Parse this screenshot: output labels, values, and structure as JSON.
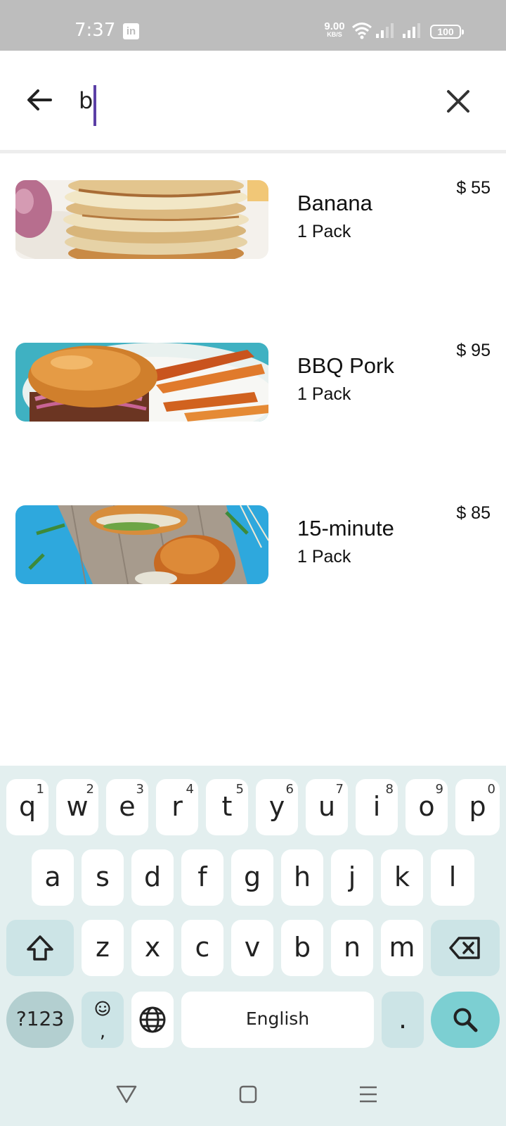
{
  "status_bar": {
    "time": "7:37",
    "notification_icon": "linkedin-icon",
    "notification_letters": "in",
    "net_speed_value": "9.00",
    "net_speed_unit": "KB/S",
    "battery": "100"
  },
  "search": {
    "query": "b",
    "back_icon": "arrow-left-icon",
    "clear_icon": "close-icon",
    "caret_color": "#5b3fa6"
  },
  "results": [
    {
      "name": "Banana",
      "quantity": "1 Pack",
      "price": "$ 55",
      "image": "pancake-stack-photo"
    },
    {
      "name": "BBQ Pork",
      "quantity": "1 Pack",
      "price": "$ 95",
      "image": "burger-with-fries-photo"
    },
    {
      "name": "15-minute",
      "quantity": "1 Pack",
      "price": "$ 85",
      "image": "burger-on-board-photo"
    }
  ],
  "keyboard": {
    "row1": [
      {
        "key": "q",
        "hint": "1"
      },
      {
        "key": "w",
        "hint": "2"
      },
      {
        "key": "e",
        "hint": "3"
      },
      {
        "key": "r",
        "hint": "4"
      },
      {
        "key": "t",
        "hint": "5"
      },
      {
        "key": "y",
        "hint": "6"
      },
      {
        "key": "u",
        "hint": "7"
      },
      {
        "key": "i",
        "hint": "8"
      },
      {
        "key": "o",
        "hint": "9"
      },
      {
        "key": "p",
        "hint": "0"
      }
    ],
    "row2": [
      "a",
      "s",
      "d",
      "f",
      "g",
      "h",
      "j",
      "k",
      "l"
    ],
    "row3": [
      "z",
      "x",
      "c",
      "v",
      "b",
      "n",
      "m"
    ],
    "symbols_label": "?123",
    "emoji_comma": ",",
    "space_label": "English",
    "period_label": ".",
    "colors": {
      "background": "#e3efef",
      "function_key": "#cce4e6",
      "search_key": "#7ccfd2"
    }
  }
}
